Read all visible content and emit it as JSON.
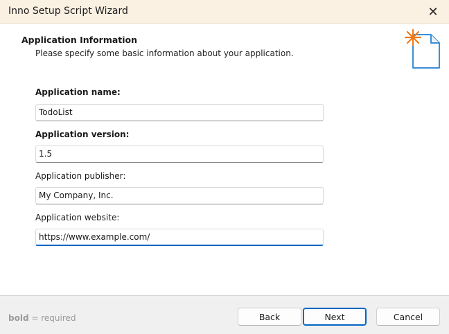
{
  "window": {
    "title": "Inno Setup Script Wizard",
    "close_glyph": "✕"
  },
  "header": {
    "title": "Application Information",
    "subtitle": "Please specify some basic information about your application.",
    "icon": "wizard-document-star-icon"
  },
  "form": {
    "app_name": {
      "label": "Application name:",
      "value": "TodoList",
      "required": true
    },
    "app_version": {
      "label": "Application version:",
      "value": "1.5",
      "required": true
    },
    "app_publisher": {
      "label": "Application publisher:",
      "value": "My Company, Inc.",
      "required": false
    },
    "app_website": {
      "label": "Application website:",
      "value": "https://www.example.com/",
      "required": false
    }
  },
  "footer": {
    "legend_bold": "bold",
    "legend_rest": " = required",
    "back_label": "Back",
    "next_label": "Next",
    "cancel_label": "Cancel"
  },
  "colors": {
    "titlebar": "#fbf1e3",
    "accent": "#0067c0",
    "star": "#f07a1a",
    "icon_outline": "#3a8fd6"
  }
}
